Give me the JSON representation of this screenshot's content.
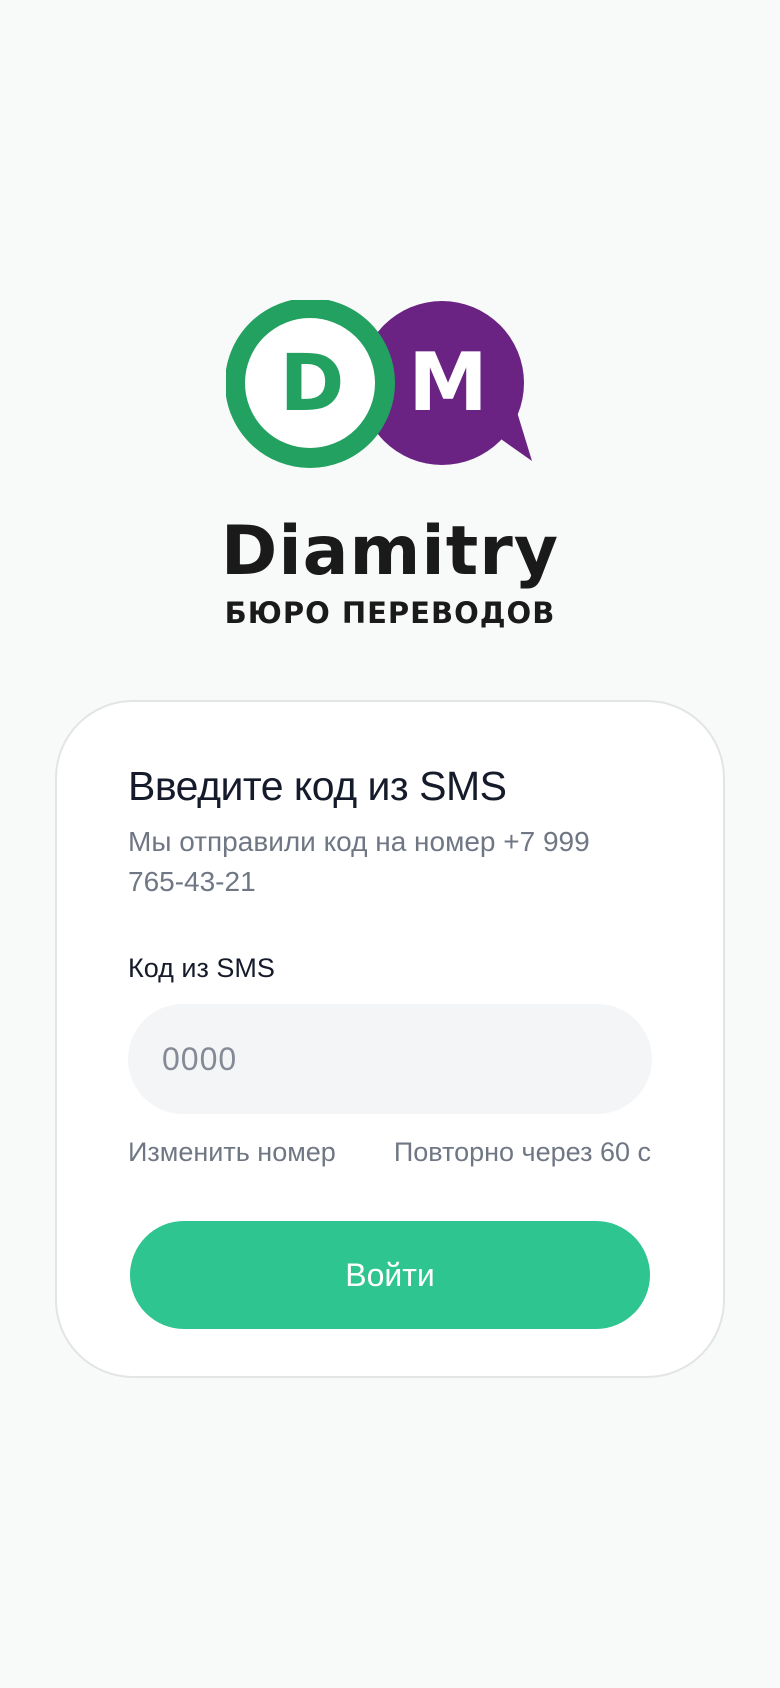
{
  "logo": {
    "letter_left": "D",
    "letter_right": "M",
    "brand": "Diamitry",
    "tagline": "БЮРО ПЕРЕВОДОВ",
    "colors": {
      "green": "#22a160",
      "purple": "#6a2383",
      "text": "#1a1a1a"
    }
  },
  "card": {
    "title": "Введите код из SMS",
    "subtitle": "Мы отправили код на номер +7 999 765-43-21",
    "field_label": "Код из SMS",
    "code_value": "",
    "code_placeholder": "0000",
    "change_number_link": "Изменить номер",
    "resend_text": "Повторно через 60 с",
    "submit_label": "Войти"
  },
  "colors": {
    "accent": "#2fc590",
    "background": "#f8f9f9",
    "card": "#ffffff",
    "input_bg": "#f3f5f6",
    "muted_text": "#707784",
    "title_text": "#161b2b"
  }
}
